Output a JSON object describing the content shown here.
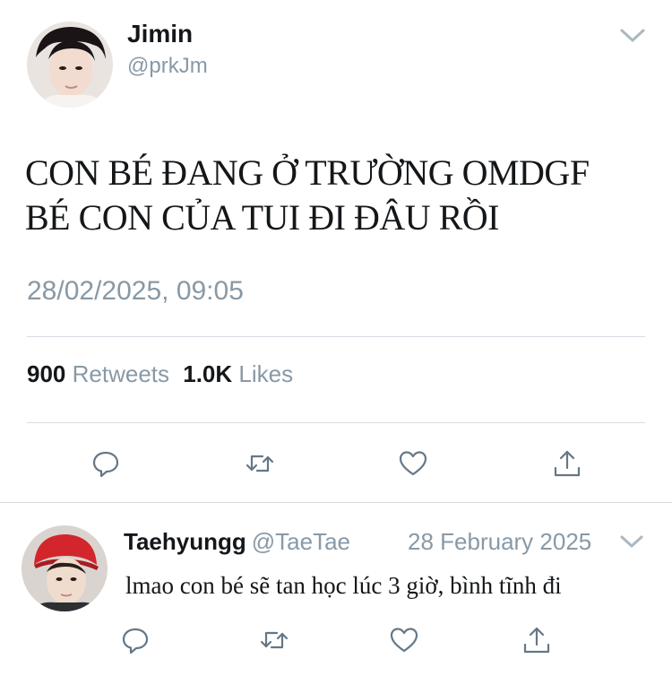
{
  "main_tweet": {
    "author_name": "Jimin",
    "author_handle": "@prkJm",
    "text_line_1": "CON BÉ ĐANG Ở TRƯỜNG OMDGF",
    "text_line_2": "BÉ CON CỦA TUI ĐI ĐÂU RỒI",
    "timestamp": "28/02/2025, 09:05",
    "retweet_count": "900",
    "retweet_label": "Retweets",
    "like_count": "1.0K",
    "like_label": "Likes"
  },
  "reply_tweet": {
    "author_name": "Taehyungg",
    "author_handle": "@TaeTae",
    "date": "28 February 2025",
    "text": "lmao con bé sẽ tan học lúc 3 giờ, bình tĩnh đi"
  },
  "icons": {
    "reply": "reply-icon",
    "retweet": "retweet-icon",
    "like": "heart-icon",
    "share": "share-icon",
    "menu": "chevron-down-icon"
  },
  "colors": {
    "text": "#14171a",
    "secondary": "#8899a6",
    "divider": "#d6dde3",
    "icon": "#657786"
  }
}
